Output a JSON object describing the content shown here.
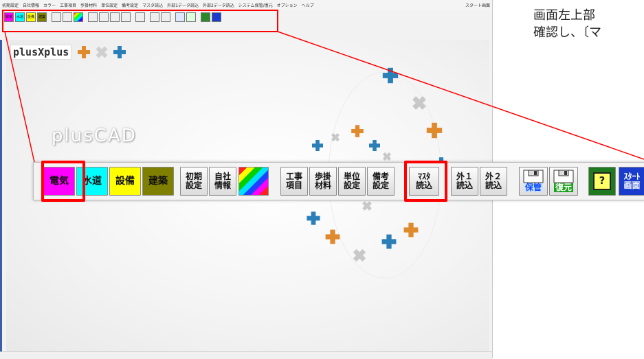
{
  "menubar": {
    "items": [
      "初期設定",
      "自社情報",
      "カラー",
      "工事項目",
      "歩掛材料",
      "単位設定",
      "備考設定",
      "マスタ読込",
      "外部1データ読込",
      "外部2データ読込",
      "システム保管/復元",
      "オプション",
      "ヘルプ"
    ],
    "right_label": "スタート画面"
  },
  "logo": {
    "text": "plusXplus"
  },
  "watermark": {
    "text": "plusCAD"
  },
  "toolbar": {
    "denki": "電気",
    "suido": "水道",
    "setsubi": "設備",
    "kenchiku": "建築",
    "shoki_1": "初期",
    "shoki_2": "設定",
    "jisha_1": "自社",
    "jisha_2": "情報",
    "koji_1": "工事",
    "koji_2": "項目",
    "bugake_1": "歩掛",
    "bugake_2": "材料",
    "tani_1": "単位",
    "tani_2": "設定",
    "biko_1": "備考",
    "biko_2": "設定",
    "master_1": "ﾏｽﾀ",
    "master_2": "読込",
    "gai1_1": "外１",
    "gai1_2": "読込",
    "gai2_1": "外２",
    "gai2_2": "読込",
    "hokan": "保管",
    "fukugen": "復元",
    "help": "?",
    "start_1": "ｽﾀｰﾄ",
    "start_2": "画面"
  },
  "small_toolbar": {
    "denki": "電気",
    "suido": "水道",
    "setsubi": "設備",
    "kenchiku": "建築"
  },
  "annotation": {
    "line1": "画面左上部",
    "line2": "確認し、〔マ"
  },
  "colors": {
    "highlight": "#ff0000",
    "denki": "#ff00ff",
    "suido": "#00ffff",
    "setsubi": "#ffff00",
    "kenchiku": "#808000",
    "blue_cross": "#2a7fb8",
    "orange_cross": "#e08a2e",
    "silver_cross": "#c8c8c8"
  }
}
